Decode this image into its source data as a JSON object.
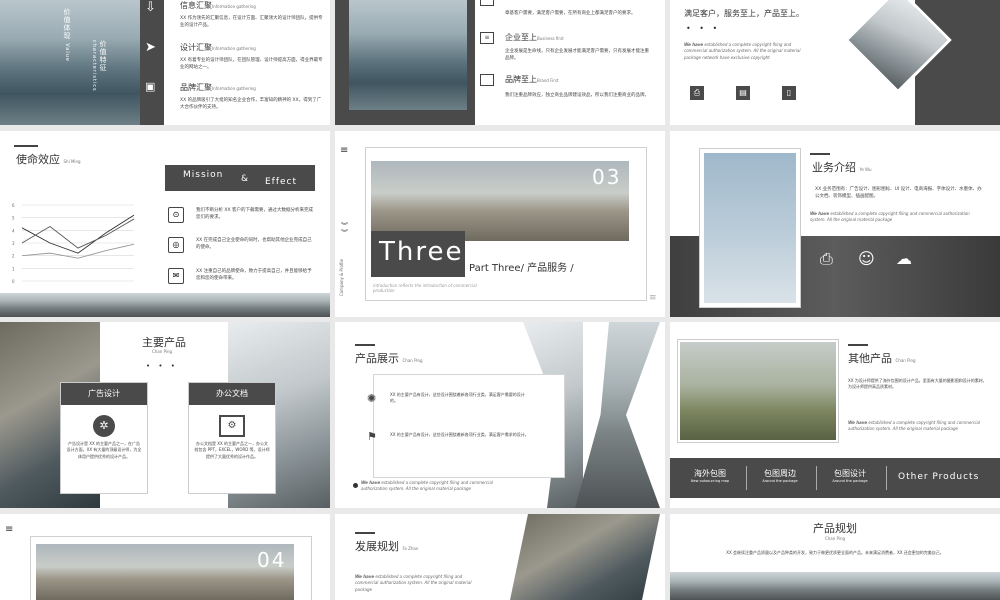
{
  "s1": {
    "vertical1": "价值体现",
    "vertical2": "Value",
    "vertical3": "价值特征",
    "vertical4": "characteristics",
    "items": [
      {
        "title": "信息汇聚",
        "en": "Information gathering",
        "body": "XX 作为领先的汇聚信息，在设计方面、汇聚领大的设计师团队，提供专业的设计产品。"
      },
      {
        "title": "设计汇聚",
        "en": "Information gathering",
        "body": "XX 有着专业的设计师团队，在团队管理、设计师提高方面，得业界最专业的网站之一。"
      },
      {
        "title": "品牌汇聚",
        "en": "Information gathering",
        "body": "XX 的品牌吸引了大批的知名企业合作，丰富知的精神的 XX，得到了广大合作伙伴的支持。"
      }
    ]
  },
  "s2": {
    "items": [
      {
        "title": "",
        "en": "",
        "body": "章基客户需要，满足客户需要，在所有商业上都满足客户的要求。"
      },
      {
        "title": "企业至上",
        "en": "Business first",
        "body": "企业发展是生命线，只有企业发展才能满足客户需要，只有发展才能注重品牌。"
      },
      {
        "title": "品牌至上",
        "en": "Brand First",
        "body": "我们注重品牌效应，独立商业品牌建设效品，所以我们注重商业的品牌。"
      }
    ]
  },
  "s3": {
    "slogan": "满足客户，服务至上，产品至上。",
    "dots": "• • •",
    "en_lead": "We have",
    "en": "established a complete copyright filing and commercial authorization system. All the original material package network have exclusive copyright"
  },
  "s4": {
    "title": "使命效应",
    "title_en": "Shi Ming",
    "mission": "Mission",
    "amp": "&",
    "effect": "Effect",
    "yticks": [
      "6",
      "5",
      "4",
      "3",
      "2",
      "1",
      "0"
    ],
    "items": [
      "我们不断分析 XX 客户的下载需要，通过大数据分析来完成您们的要求。",
      "XX 在完成自己企业使命的同时，也帮助其他企业完成自己的使命。",
      "XX 注重自己的品牌使命，致力于提高自己，并且能够给予您和您的使命带来。"
    ]
  },
  "chart_data": {
    "type": "line",
    "title": "",
    "ylim": [
      0,
      6
    ],
    "x": [
      1,
      2,
      3,
      4,
      5
    ],
    "series": [
      {
        "values": [
          4.2,
          3.0,
          2.2,
          3.8,
          5.2
        ]
      },
      {
        "values": [
          3.0,
          4.3,
          2.6,
          3.6,
          4.9
        ]
      },
      {
        "values": [
          2.0,
          2.2,
          1.8,
          2.4,
          2.9
        ]
      }
    ]
  },
  "s5": {
    "num": "03",
    "big": "Three",
    "sub": "Part Three/ 产品服务 /",
    "side": "Company & Profile",
    "desc": "introduction reflects the introduction of commercial production"
  },
  "s6": {
    "title": "业务介绍",
    "title_en": "Ye Wu",
    "body": "XX 业务范围有：广告设计、图形图标、UI 设计、电商海报、字体设计、水墨体、办公文档、装饰模型、插画配图。",
    "en_lead": "We have",
    "en": "established a complete copyright filing and commercial authorization system. All the original material package"
  },
  "s7": {
    "title": "主要产品",
    "title_en": "Chan Ping",
    "dots": "• • •",
    "cards": [
      {
        "head": "广告设计",
        "body": "产告设计是 XX 的主要产品之一，在广告设计方面，XX 有大量的顶级设计师，为全体用户提供优秀的设计产品。"
      },
      {
        "head": "办公文档",
        "body": "办公文档是 XX 的主要产品之一，办公文档包含 PPT，EXCEL，WORD 等，设计师提供了大量优秀的设计作品。"
      }
    ]
  },
  "s8": {
    "title": "产品展示",
    "title_en": "Chan Ping",
    "items": [
      "XX 的主要产品有设计，这些设计围绕着新各项行业类，满足客户需要的设计的。",
      "XX 的主要产品有设计，这些设计围绕着新各项行业类，满足客户需求的设计。"
    ],
    "en_lead": "We have",
    "en": "established a complete copyright filing and commercial authorization system. All the original material package"
  },
  "s9": {
    "title": "其他产品",
    "title_en": "Chan Ping",
    "body": "XX 为设计师提供了海外包围的设计产品，里面有大量的摄影图和设计的素材，为设计师提供高品质素材。",
    "en_lead": "We have",
    "en": "established a complete copyright filing and commercial authorization system. All the original material package",
    "tabs": [
      {
        "cn": "海外包图",
        "en": "New outsourcing map"
      },
      {
        "cn": "包图周边",
        "en": "Around the package"
      },
      {
        "cn": "包图设计",
        "en": "Around the package"
      }
    ],
    "other": "Other Products"
  },
  "s10": {
    "num": "04"
  },
  "s11": {
    "title": "发展规划",
    "title_en": "Fa Zhan",
    "en_lead": "We have",
    "en": "established a complete copyright filing and commercial authorization system. All the original material package"
  },
  "s12": {
    "title": "产品规划",
    "title_en": "Chan Ping",
    "body": "XX 会继续注重产品质量以及产品种类的开发，致力于做更优质更全面的产品。未来满足消费者，XX 还会更加的完美自己。"
  }
}
